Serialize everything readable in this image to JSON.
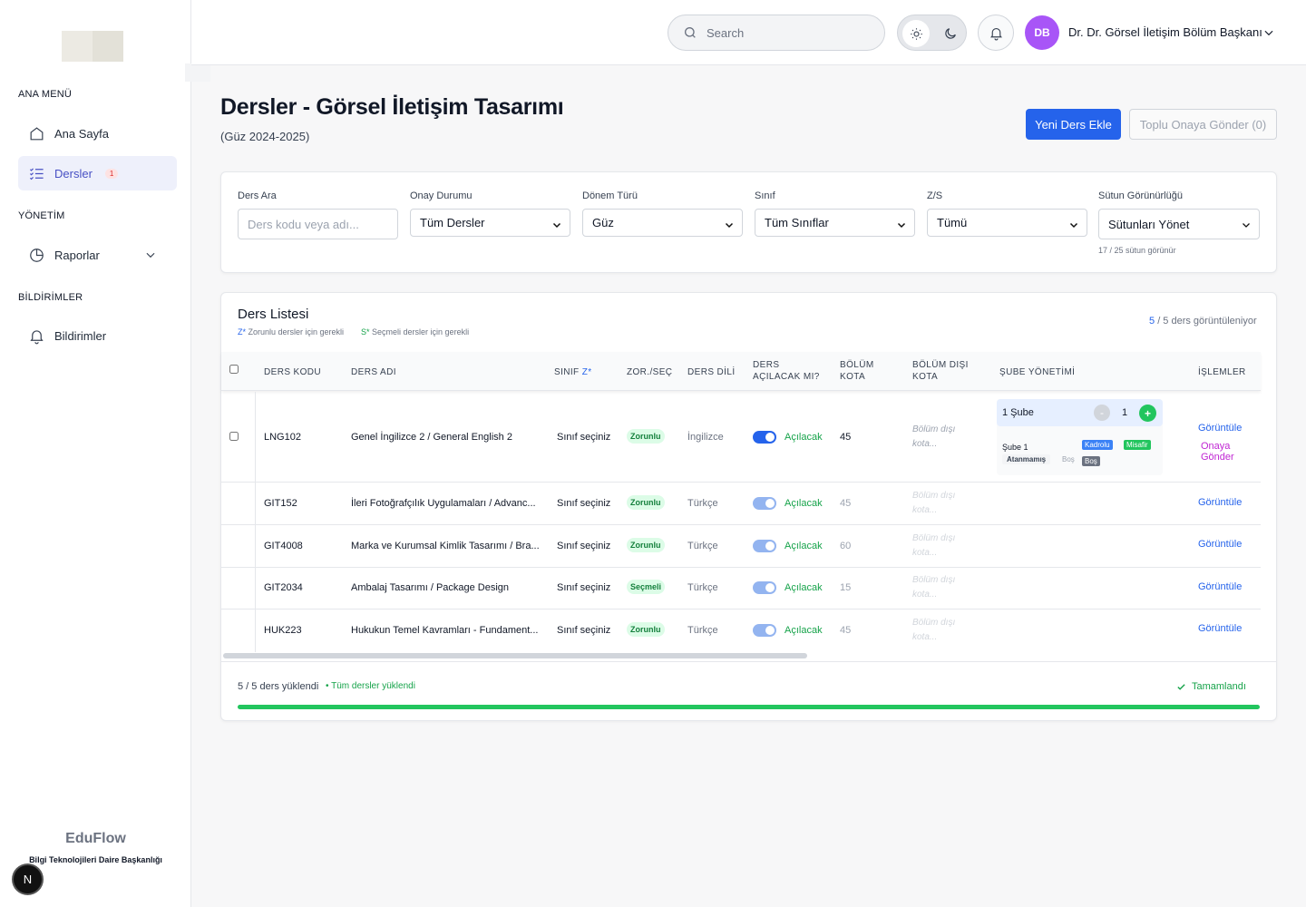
{
  "sidebar": {
    "sections": {
      "main": "ANA MENÜ",
      "admin": "YÖNETİM",
      "notifications": "BİLDİRİMLER"
    },
    "items": [
      {
        "label": "Ana Sayfa",
        "icon": "home-icon"
      },
      {
        "label": "Dersler",
        "icon": "list-check-icon",
        "badge": "1",
        "active": true
      },
      {
        "label": "Raporlar",
        "icon": "pie-chart-icon"
      },
      {
        "label": "Bildirimler",
        "icon": "bell-icon"
      }
    ],
    "brand": "EduFlow",
    "org": "Bilgi Teknolojileri Daire Başkanlığı",
    "next_badge": "N"
  },
  "header": {
    "search_placeholder": "Search",
    "avatar_initials": "DB",
    "user_name": "Dr. Dr. Görsel İletişim Bölüm Başkanı"
  },
  "page": {
    "title": "Dersler - Görsel İletişim Tasarımı",
    "subtitle": "(Güz 2024-2025)",
    "new_course_btn": "Yeni Ders Ekle",
    "bulk_approve_btn": "Toplu Onaya Gönder (0)"
  },
  "filters": {
    "search_label": "Ders Ara",
    "search_placeholder": "Ders kodu veya adı...",
    "approval_label": "Onay Durumu",
    "approval_value": "Tüm Dersler",
    "term_label": "Dönem Türü",
    "term_value": "Güz",
    "class_label": "Sınıf",
    "class_value": "Tüm Sınıflar",
    "zs_label": "Z/S",
    "zs_value": "Tümü",
    "columns_label": "Sütun Görünürlüğü",
    "columns_value": "Sütunları Yönet",
    "columns_hint": "17 / 25 sütun görünür"
  },
  "list": {
    "title": "Ders Listesi",
    "legend_z_mark": "Z*",
    "legend_z": "Zorunlu dersler için gerekli",
    "legend_s_mark": "S*",
    "legend_s": "Seçmeli dersler için gerekli",
    "count_shown": "5",
    "count_rest": "/ 5 ders görüntüleniyor",
    "columns": {
      "code": "DERS KODU",
      "name": "DERS ADI",
      "class": "SINIF",
      "class_mark": "Z*",
      "zs": "ZOR./SEÇ",
      "lang": "DERS DİLİ",
      "open1": "DERS",
      "open2": "AÇILACAK MI?",
      "quota1": "BÖLÜM",
      "quota2": "KOTA",
      "ext1": "BÖLÜM DIŞI",
      "ext2": "KOTA",
      "sections": "ŞUBE YÖNETİMİ",
      "actions": "İŞLEMLER"
    },
    "rows": [
      {
        "code": "LNG102",
        "name": "Genel İngilizce 2 / General English 2",
        "class": "Sınıf seçiniz",
        "zs": "Zorunlu",
        "lang": "İngilizce",
        "open": "Açılacak",
        "quota": "45",
        "ext_1": "Bölüm dışı",
        "ext_2": "kota...",
        "view": "Görüntüle",
        "send": "Onaya Gönder"
      },
      {
        "code": "GIT152",
        "name": "İleri Fotoğrafçılık Uygulamaları / Advanc...",
        "class": "Sınıf seçiniz",
        "zs": "Zorunlu",
        "lang": "Türkçe",
        "open": "Açılacak",
        "quota": "45",
        "ext_1": "Bölüm dışı",
        "ext_2": "kota...",
        "view": "Görüntüle"
      },
      {
        "code": "GIT4008",
        "name": "Marka ve Kurumsal Kimlik Tasarımı / Bra...",
        "class": "Sınıf seçiniz",
        "zs": "Zorunlu",
        "lang": "Türkçe",
        "open": "Açılacak",
        "quota": "60",
        "ext_1": "Bölüm dışı",
        "ext_2": "kota...",
        "view": "Görüntüle"
      },
      {
        "code": "GIT2034",
        "name": "Ambalaj Tasarımı / Package Design",
        "class": "Sınıf seçiniz",
        "zs": "Seçmeli",
        "lang": "Türkçe",
        "open": "Açılacak",
        "quota": "15",
        "ext_1": "Bölüm dışı",
        "ext_2": "kota...",
        "view": "Görüntüle"
      },
      {
        "code": "HUK223",
        "name": "Hukukun Temel Kavramları - Fundament...",
        "class": "Sınıf seçiniz",
        "zs": "Zorunlu",
        "lang": "Türkçe",
        "open": "Açılacak",
        "quota": "45",
        "ext_1": "Bölüm dışı",
        "ext_2": "kota...",
        "view": "Görüntüle"
      }
    ],
    "section_mgmt": {
      "title": "1 Şube",
      "minus": "-",
      "count": "1",
      "plus": "+",
      "name": "Şube 1",
      "kadrolu": "Kadrolu",
      "misafir": "Misafir",
      "unassigned": "Atanmamış",
      "empty1": "Boş",
      "empty2": "Boş"
    },
    "footer": {
      "loaded": "5 / 5 ders yüklendi",
      "all_loaded": "• Tüm dersler yüklendi",
      "done": "Tamamlandı",
      "progress": 1.0
    }
  },
  "colors": {
    "primary": "#2563eb",
    "success": "#16a34a",
    "avatar": "#a855f7",
    "active_nav": "#4850c4"
  }
}
